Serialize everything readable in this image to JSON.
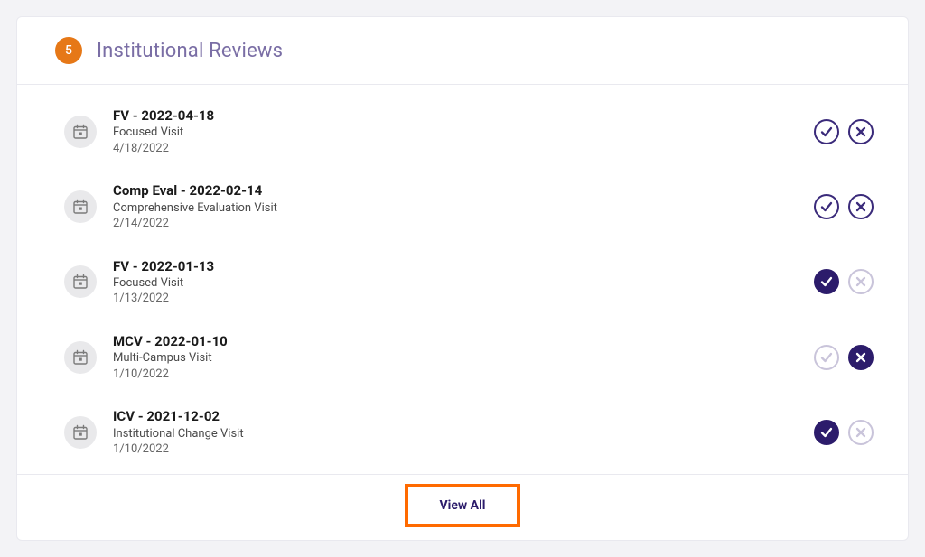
{
  "header": {
    "step_number": "5",
    "title": "Institutional Reviews"
  },
  "rows": [
    {
      "title": "FV - 2022-04-18",
      "subtitle": "Focused Visit",
      "date": "4/18/2022",
      "check": "outline",
      "cross": "outline"
    },
    {
      "title": "Comp Eval - 2022-02-14",
      "subtitle": "Comprehensive Evaluation Visit",
      "date": "2/14/2022",
      "check": "outline",
      "cross": "outline"
    },
    {
      "title": "FV - 2022-01-13",
      "subtitle": "Focused Visit",
      "date": "1/13/2022",
      "check": "solid",
      "cross": "disabled"
    },
    {
      "title": "MCV - 2022-01-10",
      "subtitle": "Multi-Campus Visit",
      "date": "1/10/2022",
      "check": "disabled",
      "cross": "solid"
    },
    {
      "title": "ICV - 2021-12-02",
      "subtitle": "Institutional Change Visit",
      "date": "1/10/2022",
      "check": "solid",
      "cross": "disabled"
    }
  ],
  "footer": {
    "view_all_label": "View All"
  }
}
